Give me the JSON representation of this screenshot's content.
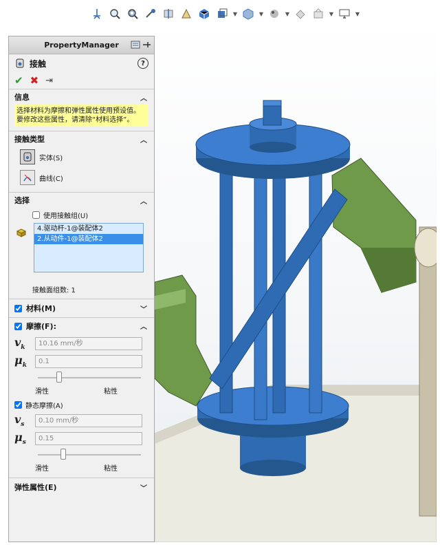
{
  "toolbar": {
    "icons": [
      "view-orient-icon",
      "zoom-fit-icon",
      "zoom-area-icon",
      "previous-view-icon",
      "section-view-icon",
      "dynamic-annotation-icon",
      "view-orientation-cube-icon",
      "display-style-icon",
      "hide-show-icon",
      "edit-appearance-icon",
      "apply-scene-icon",
      "view-settings-icon",
      "monitor-icon"
    ]
  },
  "pm": {
    "header": "PropertyManager",
    "feature_title": "接触",
    "help": "?",
    "ok": "✔",
    "cancel": "✖",
    "pin": "⇥",
    "info": {
      "title": "信息",
      "text": "选择材料为摩擦和弹性属性使用预设值。要修改这些属性，请清除“材料选择”。"
    },
    "contact_type": {
      "title": "接触类型",
      "solid": "实体(S)",
      "curve": "曲线(C)"
    },
    "selection": {
      "title": "选择",
      "use_group": "使用接触组(U)",
      "items": [
        "4.驱动杆-1@装配体2",
        "2.从动件-1@装配体2"
      ],
      "count_label": "接触面组数: 1"
    },
    "material": {
      "title": "材料(M)"
    },
    "friction": {
      "title": "摩擦(F):",
      "vk_symbol": "v",
      "vk_sub": "k",
      "vk_value": "10.16 mm/秒",
      "mk_symbol": "μ",
      "mk_sub": "k",
      "mk_value": "0.1",
      "slip": "滑性",
      "stick": "粘性",
      "slider1": 0.18,
      "static_label": "静态摩擦(A)",
      "vs_symbol": "v",
      "vs_sub": "s",
      "vs_value": "0.10 mm/秒",
      "ms_symbol": "μ",
      "ms_sub": "s",
      "ms_value": "0.15",
      "slider2": 0.22
    },
    "elastic": {
      "title": "弹性属性(E)"
    }
  },
  "colors": {
    "part_blue": "#2f6bb3",
    "part_green": "#6f9a4a",
    "highlight": "#ffff99",
    "select": "#3a8fe8"
  }
}
